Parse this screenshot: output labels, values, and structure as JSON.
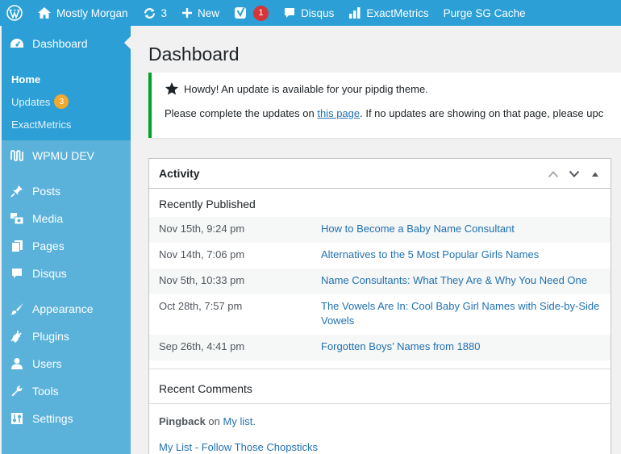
{
  "adminbar": {
    "wp_logo_icon": "wordpress-logo-icon",
    "site_name": "Mostly Morgan",
    "updates_count": "3",
    "new_label": "New",
    "yoast_badge": "1",
    "disqus_label": "Disqus",
    "exactmetrics_label": "ExactMetrics",
    "purge_label": "Purge SG Cache",
    "colors": {
      "bar": "#2b9fd6",
      "badge": "#d63638"
    }
  },
  "sidebar": {
    "dashboard_label": "Dashboard",
    "submenu": [
      {
        "label": "Home"
      },
      {
        "label": "Updates",
        "badge": "3"
      },
      {
        "label": "ExactMetrics"
      }
    ],
    "items": [
      {
        "label": "WPMU DEV",
        "icon": "wpmudev-icon"
      },
      {
        "label": "Posts",
        "icon": "pin-icon"
      },
      {
        "label": "Media",
        "icon": "media-icon"
      },
      {
        "label": "Pages",
        "icon": "pages-icon"
      },
      {
        "label": "Disqus",
        "icon": "comment-icon"
      },
      {
        "label": "Appearance",
        "icon": "brush-icon"
      },
      {
        "label": "Plugins",
        "icon": "plugin-icon"
      },
      {
        "label": "Users",
        "icon": "user-icon"
      },
      {
        "label": "Tools",
        "icon": "wrench-icon"
      },
      {
        "label": "Settings",
        "icon": "settings-icon"
      }
    ],
    "colors": {
      "bg": "#5ab2da",
      "active": "#2b9fd6"
    }
  },
  "main": {
    "title": "Dashboard",
    "notice": {
      "line1": "Howdy! An update is available for your pipdig theme.",
      "line2_before": "Please complete the updates on ",
      "line2_link": "this page",
      "line2_after": ". If no updates are showing on that page, please upc"
    },
    "activity": {
      "title": "Activity",
      "recently_published_label": "Recently Published",
      "posts": [
        {
          "date": "Nov 15th, 9:24 pm",
          "title": "How to Become a Baby Name Consultant"
        },
        {
          "date": "Nov 14th, 7:06 pm",
          "title": "Alternatives to the 5 Most Popular Girls Names"
        },
        {
          "date": "Nov 5th, 10:33 pm",
          "title": "Name Consultants: What They Are & Why You Need One"
        },
        {
          "date": "Oct 28th, 7:57 pm",
          "title": "The Vowels Are In: Cool Baby Girl Names with Side-by-Side Vowels"
        },
        {
          "date": "Sep 26th, 4:41 pm",
          "title": "Forgotten Boys’ Names from 1880"
        }
      ],
      "recent_comments_label": "Recent Comments",
      "comment1": {
        "type": "Pingback",
        "on": "on",
        "target": "My list."
      },
      "comment2": "My List - Follow Those Chopsticks"
    }
  }
}
